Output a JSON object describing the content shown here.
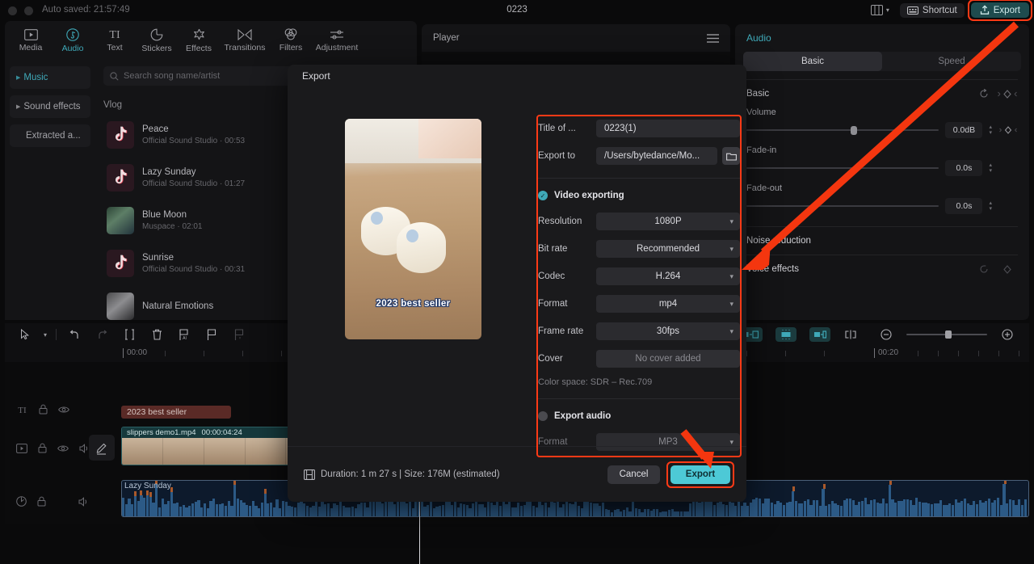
{
  "titlebar": {
    "autosave": "Auto saved: 21:57:49",
    "project_title": "0223",
    "shortcut_label": "Shortcut",
    "export_label": "Export",
    "layout_icon": "layout-icon",
    "chevron_icon": "chevron-down-icon"
  },
  "tooltabs": [
    {
      "label": "Media",
      "icon": "media-icon",
      "active": false
    },
    {
      "label": "Audio",
      "icon": "audio-note-icon",
      "active": true
    },
    {
      "label": "Text",
      "icon": "text-icon",
      "active": false
    },
    {
      "label": "Stickers",
      "icon": "sticker-icon",
      "active": false
    },
    {
      "label": "Effects",
      "icon": "effects-star-icon",
      "active": false
    },
    {
      "label": "Transitions",
      "icon": "transitions-icon",
      "active": false
    },
    {
      "label": "Filters",
      "icon": "filters-icon",
      "active": false
    },
    {
      "label": "Adjustment",
      "icon": "adjustment-sliders-icon",
      "active": false
    }
  ],
  "left_panel": {
    "categories": [
      {
        "label": "Music",
        "active": true,
        "arrow": true
      },
      {
        "label": "Sound effects",
        "active": false,
        "arrow": true
      },
      {
        "label": "Extracted a...",
        "active": false,
        "arrow": false
      }
    ],
    "search_placeholder": "Search song name/artist",
    "group_title": "Vlog",
    "songs": [
      {
        "name": "Peace",
        "meta": "Official Sound Studio · 00:53",
        "cover": "tiktok"
      },
      {
        "name": "Lazy Sunday",
        "meta": "Official Sound Studio · 01:27",
        "cover": "tiktok"
      },
      {
        "name": "Blue Moon",
        "meta": "Muspace · 02:01",
        "cover": "photo"
      },
      {
        "name": "Sunrise",
        "meta": "Official Sound Studio · 00:31",
        "cover": "tiktok"
      },
      {
        "name": "Natural Emotions",
        "meta": "",
        "cover": "photo2"
      }
    ]
  },
  "player": {
    "title": "Player",
    "menu_icon": "hamburger-icon"
  },
  "right_panel": {
    "title": "Audio",
    "tabs": [
      {
        "label": "Basic",
        "active": true
      },
      {
        "label": "Speed",
        "active": false
      }
    ],
    "sections": {
      "basic": {
        "title": "Basic",
        "reset_icon": "reset-icon",
        "keyframe_icon": "keyframe-diamond-icon",
        "controls": [
          {
            "label": "Volume",
            "value": "0.0dB"
          },
          {
            "label": "Fade-in",
            "value": "0.0s"
          },
          {
            "label": "Fade-out",
            "value": "0.0s"
          }
        ]
      },
      "noise_reduction": {
        "title": "Noise reduction"
      },
      "voice_effects": {
        "title": "Voice effects"
      }
    }
  },
  "timeline": {
    "toolbar_icons": [
      "select-arrow-icon",
      "chevron-down-icon",
      "undo-icon",
      "redo-icon",
      "split-icon",
      "delete-trash-icon",
      "ai-marker-icon",
      "flag-icon",
      "flag-delete-icon"
    ],
    "right_icons": [
      "microphone-icon",
      "mirror-left-icon",
      "auto-cut-icon",
      "mirror-right-icon",
      "crop-split-icon",
      "zoom-out-icon",
      "zoom-in-icon"
    ],
    "ruler_labels": [
      "00:00",
      "00:20"
    ],
    "track_headers": [
      {
        "icons": [
          "text-track-icon",
          "lock-icon",
          "eye-icon"
        ]
      },
      {
        "icons": [
          "video-track-icon",
          "lock-icon",
          "eye-icon",
          "speaker-icon"
        ]
      },
      {
        "icons": [
          "audio-track-icon",
          "lock-icon",
          "speaker-icon"
        ]
      }
    ],
    "clips": {
      "text_clip": "2023 best seller",
      "video_clip_name": "slippers demo1.mp4",
      "video_clip_duration": "00:00:04:24",
      "audio_clip_name": "Lazy Sunday"
    },
    "edit_chip_icon": "pencil-edit-icon"
  },
  "dialog": {
    "title": "Export",
    "thumbnail_caption": "2023 best seller",
    "fields": {
      "title_label": "Title of ...",
      "title_value": "0223(1)",
      "export_to_label": "Export to",
      "export_to_value": "/Users/bytedance/Mo...",
      "folder_icon": "folder-icon"
    },
    "video_section": {
      "checkbox_label": "Video exporting",
      "checked": true,
      "rows": [
        {
          "label": "Resolution",
          "value": "1080P",
          "type": "select"
        },
        {
          "label": "Bit rate",
          "value": "Recommended",
          "type": "select"
        },
        {
          "label": "Codec",
          "value": "H.264",
          "type": "select"
        },
        {
          "label": "Format",
          "value": "mp4",
          "type": "select"
        },
        {
          "label": "Frame rate",
          "value": "30fps",
          "type": "select"
        },
        {
          "label": "Cover",
          "value": "No cover added",
          "type": "flat"
        }
      ],
      "color_space": "Color space: SDR – Rec.709"
    },
    "audio_section": {
      "checkbox_label": "Export audio",
      "checked": false,
      "rows": [
        {
          "label": "Format",
          "value": "MP3",
          "type": "select"
        }
      ]
    },
    "footer": {
      "duration_text": "Duration: 1 m 27 s | Size: 176M (estimated)",
      "film_icon": "film-icon",
      "cancel_label": "Cancel",
      "export_label": "Export"
    }
  },
  "colors": {
    "accent_teal": "#3fa9b8",
    "export_cyan": "#4dc9d6",
    "highlight_red": "#ff3a16",
    "panel_bg": "#141416",
    "dialog_bg": "#1a1a1c"
  }
}
